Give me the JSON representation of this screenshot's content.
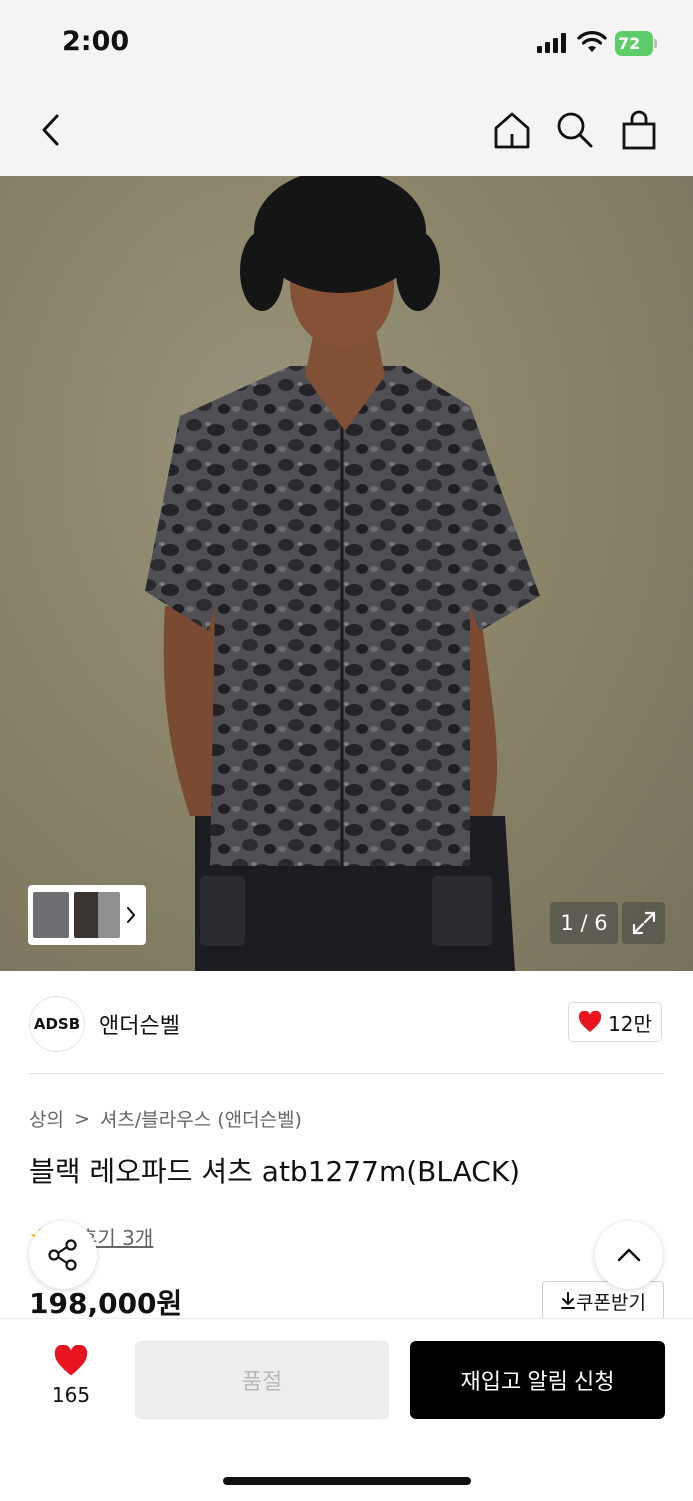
{
  "status_bar": {
    "time": "2:00",
    "battery": "72"
  },
  "gallery": {
    "counter": "1 / 6"
  },
  "brand": {
    "logo_text": "ADSB",
    "name": "앤더슨벨",
    "likes": "12만"
  },
  "breadcrumb": {
    "category": "상의",
    "separator": ">",
    "subcategory": "셔츠/블라우스 (앤더슨벨)"
  },
  "product": {
    "title": "블랙 레오파드 셔츠 atb1277m(BLACK)",
    "review_link": "후기 3개",
    "price": "198,000원"
  },
  "coupon": {
    "label": "쿠폰받기"
  },
  "bottom_bar": {
    "wish_count": "165",
    "soldout_label": "품절",
    "restock_label": "재입고 알림 신청"
  },
  "colors": {
    "accent_red": "#e8141f",
    "battery_green": "#5bcc68"
  },
  "icons": [
    "back-icon",
    "home-icon",
    "search-icon",
    "bag-icon",
    "chevron-right-icon",
    "expand-icon",
    "heart-icon",
    "share-icon",
    "chevron-up-icon",
    "download-icon",
    "star-icon"
  ]
}
